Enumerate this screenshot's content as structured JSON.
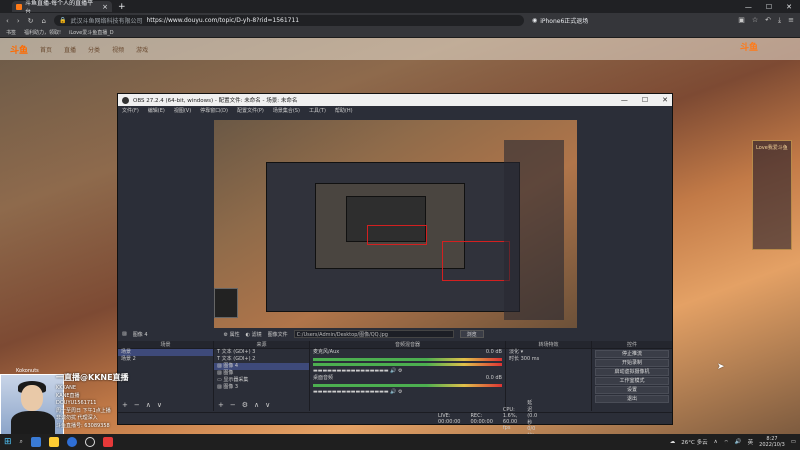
{
  "browser": {
    "tab_title": "斗鱼直播-每个人的直播平台",
    "url_site": "武汉斗鱼网络科技有限公司",
    "url": "https://www.douyu.com/topic/D-yh-8?rid=1561711",
    "promo": "iPhone6正式退场",
    "bookmarks": [
      "书签",
      "福利助力，领取!",
      "iLove爱斗鱼直播_D"
    ]
  },
  "site": {
    "logo": "斗鱼",
    "nav": [
      "首页",
      "直播",
      "分类",
      "视频",
      "游戏"
    ],
    "brand_right": "斗鱼",
    "side_ad": "Love我爱斗鱼"
  },
  "obs": {
    "title": "OBS 27.2.4 (64-bit, windows) - 配置文件: 未命名 - 场景: 未命名",
    "menu": [
      "文件(F)",
      "编辑(E)",
      "视图(V)",
      "停靠窗口(D)",
      "配置文件(P)",
      "场景集合(S)",
      "工具(T)",
      "帮助(H)"
    ],
    "source_label": "图像 4",
    "props_btn": "属性",
    "filters_btn": "滤镜",
    "image_file_label": "图像文件",
    "image_path": "C:/Users/Admin/Desktop/图像/QQ.jpg",
    "browse_btn": "浏览",
    "docks": {
      "scenes": {
        "title": "场景",
        "items": [
          "场景",
          "场景 2"
        ]
      },
      "sources": {
        "title": "来源",
        "items": [
          "文本 (GDI+) 3",
          "文本 (GDI+) 2",
          "图像 4",
          "图像",
          "显示器采集",
          "图像 3"
        ]
      },
      "mixer": {
        "title": "音频混音器",
        "tracks": [
          {
            "name": "麦克风/Aux",
            "db": "0.0 dB"
          },
          {
            "name": "桌面音频",
            "db": "0.0 dB"
          }
        ]
      },
      "transitions": {
        "title": "转场特效",
        "type": "淡化",
        "duration_label": "时长",
        "duration": "300 ms"
      },
      "controls": {
        "title": "控件",
        "buttons": [
          "停止推流",
          "开始录制",
          "启动虚拟摄像机",
          "工作室模式",
          "设置",
          "退出"
        ]
      }
    },
    "status": {
      "live": "LIVE: 00:00:00",
      "rec": "REC: 00:00:00",
      "cpu": "CPU: 1.6%, 60.00 fps",
      "note": "延迟 (0.0 秒 0/0 帧)"
    }
  },
  "overlay": {
    "top_small": "Kokonuts",
    "caption": "一直播@KKNE直播",
    "lines": [
      "KKKANE",
      "KANE直播",
      "DOUYU1561711",
      "周一至周日 下午1点上播",
      "非诚勿扰 代理深入",
      "斗鱼直播号: 63089358"
    ]
  },
  "taskbar": {
    "weather": "26°C 多云",
    "lang": "英",
    "time": "8:27",
    "date": "2022/10/3"
  }
}
